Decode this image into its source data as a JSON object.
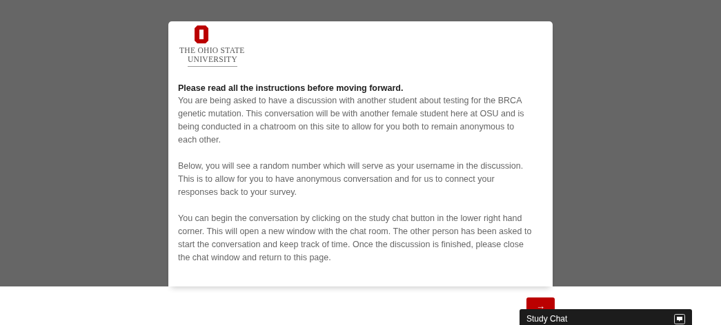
{
  "logo": {
    "line_1": "THE OHIO STATE",
    "line_2": "UNIVERSITY"
  },
  "heading": "Please read all the instructions before moving forward.",
  "paragraphs": [
    "You are being asked to have a discussion with another student about testing for the BRCA genetic mutation. This conversation will be with another female student here at OSU and is being conducted in a chatroom on this site to allow for you both to remain anonymous to each other.",
    "Below, you will see a random number which will serve as your username in the discussion. This is to allow for you to have anonymous conversation and for us to connect your responses back to your survey.",
    "You can begin the conversation by clicking on the study chat button in the lower right hand corner. This will open a new window with the chat room. The other person has been asked to start the conversation and keep track of time. Once the discussion is finished, please close the chat window and return to this page."
  ],
  "next_button": {
    "label": "→"
  },
  "chat_bar": {
    "title": "Study Chat"
  }
}
